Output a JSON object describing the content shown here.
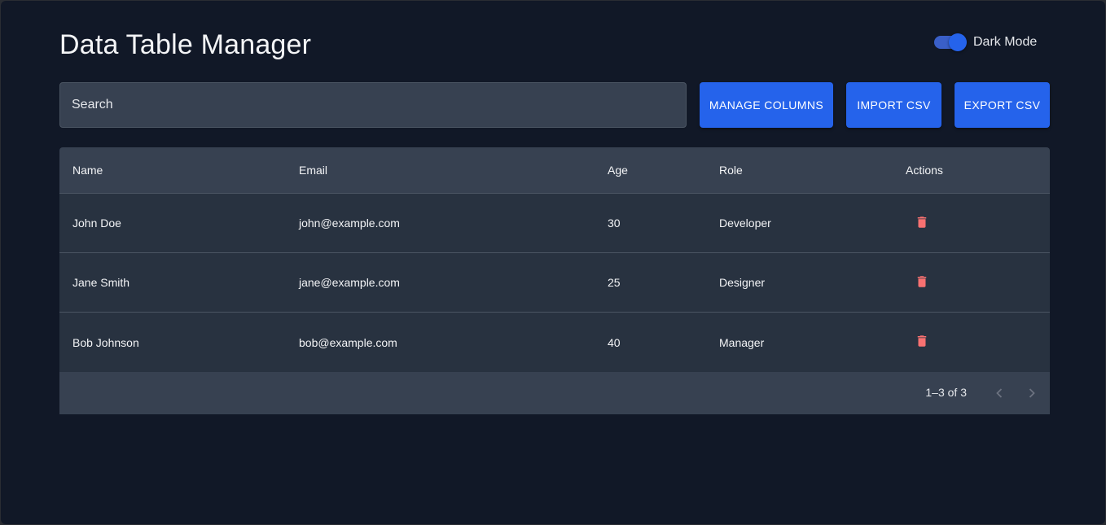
{
  "header": {
    "title": "Data Table Manager",
    "dark_mode_label": "Dark Mode",
    "dark_mode_enabled": true
  },
  "toolbar": {
    "search_placeholder": "Search",
    "manage_columns_label": "MANAGE COLUMNS",
    "import_label": "IMPORT CSV",
    "export_label": "EXPORT CSV"
  },
  "table": {
    "columns": [
      "Name",
      "Email",
      "Age",
      "Role",
      "Actions"
    ],
    "rows": [
      {
        "name": "John Doe",
        "email": "john@example.com",
        "age": "30",
        "role": "Developer"
      },
      {
        "name": "Jane Smith",
        "email": "jane@example.com",
        "age": "25",
        "role": "Designer"
      },
      {
        "name": "Bob Johnson",
        "email": "bob@example.com",
        "age": "40",
        "role": "Manager"
      }
    ],
    "row_action_icon": "trash-icon"
  },
  "pagination": {
    "range_text": "1–3 of 3",
    "prev_icon": "chevron-left-icon",
    "next_icon": "chevron-right-icon"
  },
  "colors": {
    "background": "#111827",
    "accent": "#2563eb",
    "delete": "#f87171"
  }
}
